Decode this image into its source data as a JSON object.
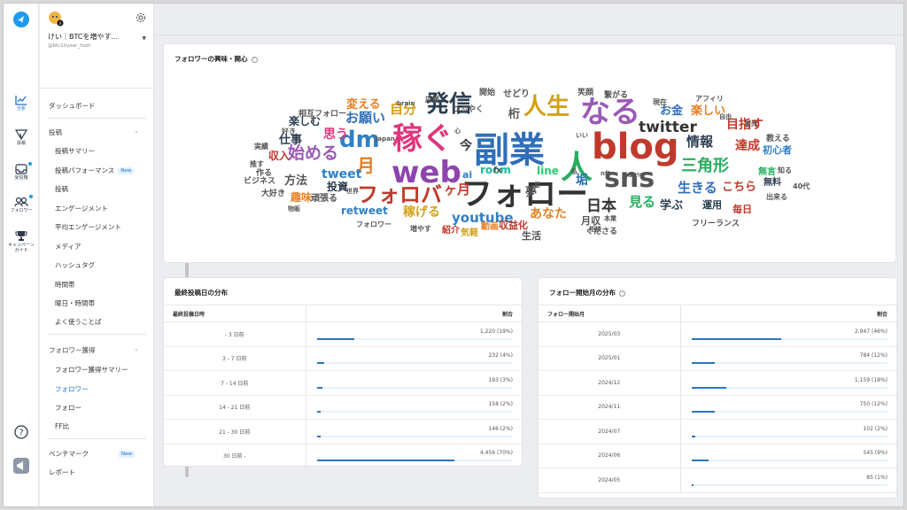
{
  "rail": {
    "items": [
      {
        "label": "分析",
        "icon": "chart-line-icon"
      },
      {
        "label": "投稿",
        "icon": "send-icon"
      },
      {
        "label": "受信箱",
        "icon": "inbox-icon"
      },
      {
        "label": "フォロワー",
        "icon": "users-icon"
      },
      {
        "label": "キャンペーンガイド",
        "icon": "trophy-icon"
      }
    ]
  },
  "account": {
    "name": "けい｜BTCを増やす...",
    "handle": "@btc10year_hodl"
  },
  "sidebar": {
    "dashboard": "ダッシュボード",
    "posts_header": "投稿",
    "posts_items": [
      "投稿サマリー",
      "投稿パフォーマンス",
      "投稿",
      "エンゲージメント",
      "平均エンゲージメント",
      "メディア",
      "ハッシュタグ",
      "時間帯",
      "曜日・時間帯",
      "よく使うことば"
    ],
    "new_badge": "New",
    "followers_header": "フォロワー獲得",
    "followers_items": [
      "フォロワー獲得サマリー",
      "フォロワー",
      "フォロー",
      "FF比"
    ],
    "benchmark": "ベンチマーク",
    "report": "レポート"
  },
  "cloud_card": {
    "title": "フォロワーの興味・関心",
    "words": [
      {
        "t": "副業",
        "c": "#2f6fba"
      },
      {
        "t": "フォロー",
        "c": "#333333"
      },
      {
        "t": "稼ぐ",
        "c": "#e0357a"
      },
      {
        "t": "blog",
        "c": "#c0392b"
      },
      {
        "t": "なる",
        "c": "#9b59b6"
      },
      {
        "t": "人",
        "c": "#27ae60"
      },
      {
        "t": "web",
        "c": "#8e44ad"
      },
      {
        "t": "sns",
        "c": "#555555"
      },
      {
        "t": "人生",
        "c": "#d4a017"
      },
      {
        "t": "発信",
        "c": "#2c3e50"
      },
      {
        "t": "dm",
        "c": "#2f80c4"
      },
      {
        "t": "フォロバ",
        "c": "#c0392b"
      },
      {
        "t": "twitter",
        "c": "#333333"
      },
      {
        "t": "三角形",
        "c": "#27ae60"
      },
      {
        "t": "月",
        "c": "#e67e22"
      },
      {
        "t": "自分",
        "c": "#d4a017"
      },
      {
        "t": "始める",
        "c": "#9b59b6"
      },
      {
        "t": "日本",
        "c": "#333333"
      },
      {
        "t": "情報",
        "c": "#2c3e50"
      },
      {
        "t": "youtube",
        "c": "#2f80c4"
      },
      {
        "t": "稼げる",
        "c": "#d4a017"
      },
      {
        "t": "生きる",
        "c": "#2f6fba"
      },
      {
        "t": "tweet",
        "c": "#2f80c4"
      },
      {
        "t": "お願い",
        "c": "#2f6fba"
      },
      {
        "t": "あなた",
        "c": "#e67e22"
      },
      {
        "t": "見る",
        "c": "#27ae60"
      },
      {
        "t": "ヶ月",
        "c": "#c0392b"
      },
      {
        "t": "達成",
        "c": "#c0392b"
      },
      {
        "t": "思う",
        "c": "#e0357a"
      },
      {
        "t": "目指す",
        "c": "#c0392b"
      },
      {
        "t": "お金",
        "c": "#2f6fba"
      },
      {
        "t": "こちら",
        "c": "#c0392b"
      },
      {
        "t": "変える",
        "c": "#e67e22"
      },
      {
        "t": "room",
        "c": "#1abc9c"
      },
      {
        "t": "line",
        "c": "#2ecc71"
      },
      {
        "t": "垢",
        "c": "#2f6fba"
      },
      {
        "t": "今",
        "c": "#333333"
      },
      {
        "t": "学ぶ",
        "c": "#2c3e50"
      },
      {
        "t": "楽しい",
        "c": "#e67e22"
      },
      {
        "t": "投資",
        "c": "#2c3e50"
      },
      {
        "t": "方法",
        "c": "#555555"
      },
      {
        "t": "趣味",
        "c": "#e67e22"
      },
      {
        "t": "retweet",
        "c": "#2f80c4"
      },
      {
        "t": "仕事",
        "c": "#2c3e50"
      },
      {
        "t": "収入",
        "c": "#c0392b"
      },
      {
        "t": "楽しむ",
        "c": "#2c3e50"
      },
      {
        "t": "運用",
        "c": "#2c3e50"
      },
      {
        "t": "無言",
        "c": "#27ae60"
      },
      {
        "t": "初心者",
        "c": "#2f80c4"
      },
      {
        "t": "無料",
        "c": "#2c3e50"
      },
      {
        "t": "毎日",
        "c": "#c0392b"
      },
      {
        "t": "収益化",
        "c": "#c0392b"
      },
      {
        "t": "生活",
        "c": "#555555"
      },
      {
        "t": "動画",
        "c": "#e67e22"
      },
      {
        "t": "紹介",
        "c": "#c0392b"
      },
      {
        "t": "気軽",
        "c": "#d4a017"
      },
      {
        "t": "月収",
        "c": "#555555"
      },
      {
        "t": "フリーランス",
        "c": "#555555"
      },
      {
        "t": "教える",
        "c": "#555555"
      },
      {
        "t": "桁",
        "c": "#555555"
      },
      {
        "t": "夢",
        "c": "#555555"
      },
      {
        "t": "ai",
        "c": "#2f80c4"
      },
      {
        "t": "fx",
        "c": "#555555"
      },
      {
        "t": "頑張る",
        "c": "#555555"
      },
      {
        "t": "作る",
        "c": "#555555"
      },
      {
        "t": "大好き",
        "c": "#555555"
      },
      {
        "t": "ビジネス",
        "c": "#555555"
      },
      {
        "t": "相互フォロー",
        "c": "#555555"
      },
      {
        "t": "フォロワー",
        "c": "#555555"
      },
      {
        "t": "増やす",
        "c": "#555555"
      },
      {
        "t": "くださる",
        "c": "#555555"
      },
      {
        "t": "つぶやく",
        "c": "#555555"
      },
      {
        "t": "開始",
        "c": "#555555"
      },
      {
        "t": "せどり",
        "c": "#555555"
      },
      {
        "t": "笑顔",
        "c": "#555555"
      },
      {
        "t": "繋がる",
        "c": "#555555"
      },
      {
        "t": "現在",
        "c": "#555555"
      },
      {
        "t": "アフィリ",
        "c": "#555555"
      },
      {
        "t": "自由",
        "c": "#555555"
      },
      {
        "t": "販売",
        "c": "#555555"
      },
      {
        "t": "知る",
        "c": "#555555"
      },
      {
        "t": "40代",
        "c": "#555555"
      },
      {
        "t": "出来る",
        "c": "#555555"
      },
      {
        "t": "brain",
        "c": "#555555"
      },
      {
        "t": "応援",
        "c": "#555555"
      },
      {
        "t": "japan",
        "c": "#555555"
      },
      {
        "t": "好き",
        "c": "#555555"
      },
      {
        "t": "実績",
        "c": "#555555"
      },
      {
        "t": "推す",
        "c": "#555555"
      },
      {
        "t": "物販",
        "c": "#555555"
      },
      {
        "t": "世界",
        "c": "#555555"
      },
      {
        "t": "本業",
        "c": "#555555"
      },
      {
        "t": "相談",
        "c": "#555555"
      },
      {
        "t": "nft",
        "c": "#555555"
      },
      {
        "t": "100%",
        "c": "#555555"
      },
      {
        "t": "私",
        "c": "#555555"
      },
      {
        "t": "いい",
        "c": "#555555"
      },
      {
        "t": "心",
        "c": "#555555"
      },
      {
        "t": "星",
        "c": "#555555"
      }
    ]
  },
  "last_post": {
    "title": "最終投稿日の分布",
    "col_key": "最終投稿日時",
    "col_val": "割合",
    "rows": [
      {
        "k": "- 3 日前",
        "v": "1,220 (19%)",
        "pct": 19
      },
      {
        "k": "3 - 7 日前",
        "v": "232 (4%)",
        "pct": 4
      },
      {
        "k": "7 - 14 日前",
        "v": "193 (3%)",
        "pct": 3
      },
      {
        "k": "14 - 21 日前",
        "v": "158 (2%)",
        "pct": 2
      },
      {
        "k": "21 - 30 日前",
        "v": "146 (2%)",
        "pct": 2
      },
      {
        "k": "30 日前 -",
        "v": "4,456 (70%)",
        "pct": 70
      }
    ]
  },
  "follow_start": {
    "title": "フォロー開始月の分布",
    "col_key": "フォロー開始月",
    "col_val": "割合",
    "rows": [
      {
        "k": "2025/03",
        "v": "2,947 (46%)",
        "pct": 46
      },
      {
        "k": "2025/01",
        "v": "784 (12%)",
        "pct": 12
      },
      {
        "k": "2024/12",
        "v": "1,159 (18%)",
        "pct": 18
      },
      {
        "k": "2024/11",
        "v": "750 (12%)",
        "pct": 12
      },
      {
        "k": "2024/07",
        "v": "102 (2%)",
        "pct": 2
      },
      {
        "k": "2024/06",
        "v": "545 (9%)",
        "pct": 9
      },
      {
        "k": "2024/05",
        "v": "85 (1%)",
        "pct": 1
      }
    ]
  }
}
